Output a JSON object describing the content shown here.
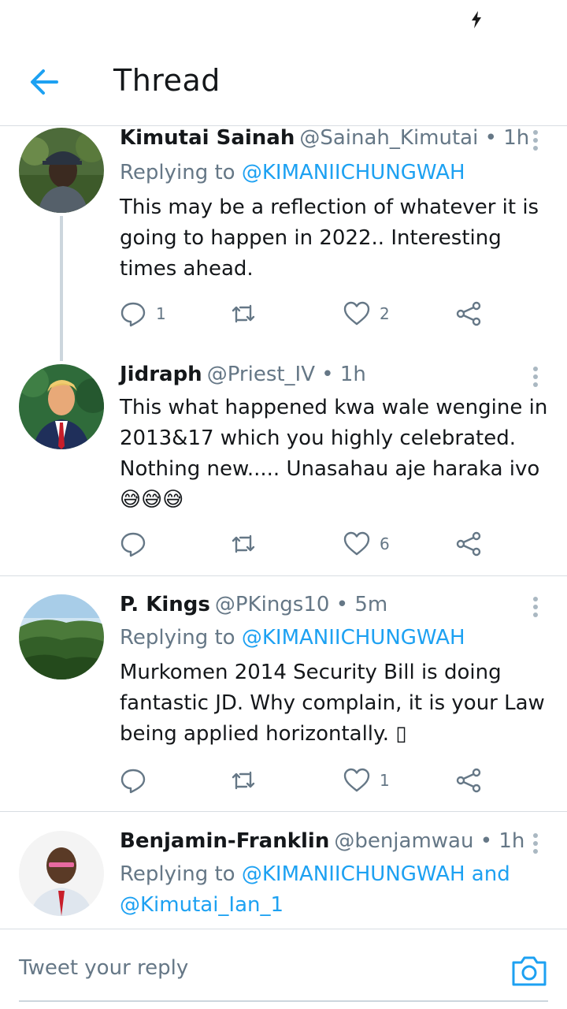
{
  "status_bar": {
    "icon": "charging-bolt-icon"
  },
  "header": {
    "title": "Thread",
    "back_icon": "arrow-left-icon"
  },
  "tweets": [
    {
      "name": "Kimutai Sainah",
      "handle": "@Sainah_Kimutai",
      "time": "• 1h",
      "replying_prefix": "Replying to ",
      "replying_to": "@KIMANIICHUNGWAH",
      "replying_and": "",
      "replying_to_2": "",
      "text": "This may be a reflection of whatever it is going to happen in 2022.. Interesting times ahead.",
      "replies": "1",
      "retweets": "",
      "likes": "2"
    },
    {
      "name": "Jidraph",
      "handle": "@Priest_IV",
      "time": "• 1h",
      "text": "This what happened kwa wale wengine in 2013&17 which you highly celebrated. Nothing new..... Unasahau aje haraka ivo😅😅😅",
      "replies": "",
      "retweets": "",
      "likes": "6"
    },
    {
      "name": "P. Kings",
      "handle": "@PKings10",
      "time": "• 5m",
      "replying_prefix": "Replying to ",
      "replying_to": "@KIMANIICHUNGWAH",
      "text": "Murkomen 2014 Security Bill is doing fantastic JD. Why complain, it is your Law being applied horizontally. ▯",
      "replies": "",
      "retweets": "",
      "likes": "1"
    },
    {
      "name": "Benjamin-Franklin",
      "handle": "@benjamwau",
      "time": "• 1h",
      "replying_prefix": "Replying to ",
      "replying_to": "@KIMANIICHUNGWAH",
      "replying_and": " and",
      "replying_to_2": "@Kimutai_Ian_1"
    }
  ],
  "composer": {
    "placeholder": "Tweet your reply",
    "camera_icon": "camera-icon"
  },
  "colors": {
    "accent": "#1da1f2",
    "text": "#14171a",
    "muted": "#657786",
    "divider": "#d8dde2"
  }
}
